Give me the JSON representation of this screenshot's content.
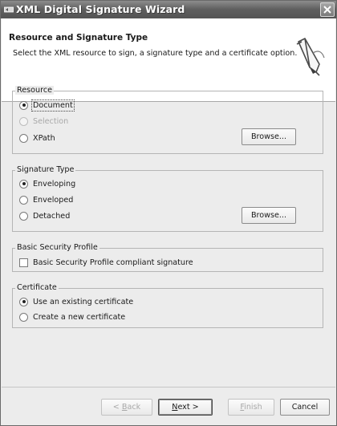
{
  "window": {
    "title": "XML Digital Signature Wizard"
  },
  "header": {
    "title": "Resource and Signature Type",
    "description": "Select the XML resource to sign, a signature type and a certificate option.",
    "icon": "pen-icon"
  },
  "groups": {
    "resource": {
      "legend": "Resource",
      "options": [
        {
          "label": "Document",
          "checked": true,
          "disabled": false
        },
        {
          "label": "Selection",
          "checked": false,
          "disabled": true
        },
        {
          "label": "XPath",
          "checked": false,
          "disabled": false
        }
      ],
      "browse_label": "Browse..."
    },
    "signature_type": {
      "legend": "Signature Type",
      "options": [
        {
          "label": "Enveloping",
          "checked": true
        },
        {
          "label": "Enveloped",
          "checked": false
        },
        {
          "label": "Detached",
          "checked": false
        }
      ],
      "browse_label": "Browse..."
    },
    "security_profile": {
      "legend": "Basic Security Profile",
      "checkbox_label": "Basic Security Profile compliant signature",
      "checked": false
    },
    "certificate": {
      "legend": "Certificate",
      "options": [
        {
          "label": "Use an existing certificate",
          "checked": true
        },
        {
          "label": "Create a new certificate",
          "checked": false
        }
      ]
    }
  },
  "buttons": {
    "back_pre": "< ",
    "back_mn": "B",
    "back_post": "ack",
    "next_mn": "N",
    "next_post": "ext >",
    "finish_mn": "F",
    "finish_post": "inish",
    "cancel": "Cancel"
  }
}
